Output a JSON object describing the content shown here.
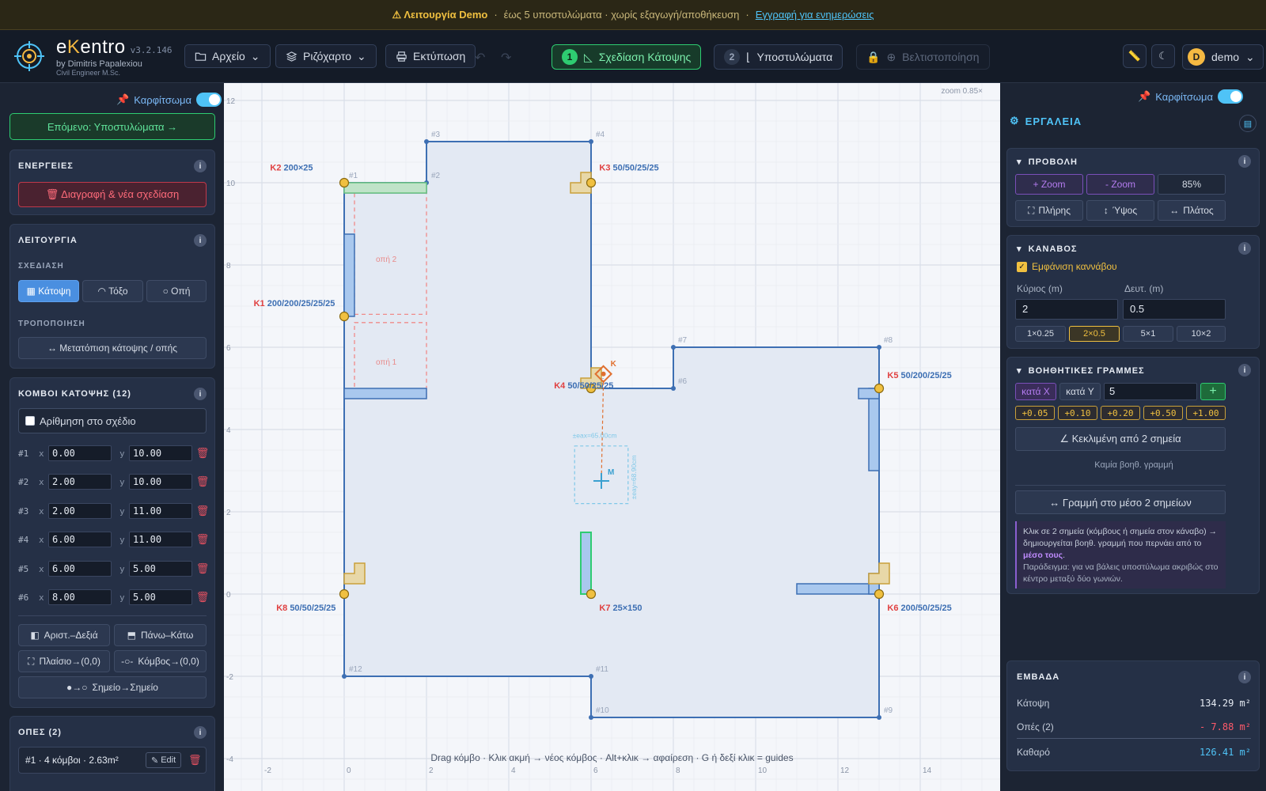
{
  "banner": {
    "warning": "⚠ Λειτουργία Demo",
    "sep1": "·",
    "limits": "έως 5 υποστυλώματα · χωρίς εξαγωγή/αποθήκευση",
    "sep2": "·",
    "link": "Εγγραφή για ενημερώσεις"
  },
  "header": {
    "brand_e": "e",
    "brand_k": "K",
    "brand_rest": "entro",
    "version": "v3.2.146",
    "by": "by Dimitris Papalexiou",
    "role": "Civil Engineer M.Sc.",
    "file_menu": "Αρχείο",
    "layers_menu": "Ριζόχαρτο",
    "print": "Εκτύπωση",
    "step1_num": "1",
    "step1_label": "Σχεδίαση Κάτοψης",
    "step2_num": "2",
    "step2_label": "Υποστυλώματα",
    "step3_label": "Βελτιστοποίηση",
    "user_initial": "D",
    "user_name": "demo"
  },
  "left": {
    "pin_label": "Καρφίτσωμα",
    "next_button": "Επόμενο: Υποστυλώματα →",
    "actions_title": "ΕΝΕΡΓΕΙΕΣ",
    "delete_button": "🗑 Διαγραφή & νέα σχεδίαση",
    "mode_title": "ΛΕΙΤΟΥΡΓΙΑ",
    "draw_sub": "ΣΧΕΔΙΑΣΗ",
    "mode_plan": "▦ Κάτοψη",
    "mode_arc": "◠ Τόξο",
    "mode_hole": "○ Οπή",
    "modify_sub": "ΤΡΟΠΟΠΟΙΗΣΗ",
    "move_button": "↔ Μετατόπιση κάτοψης / οπής",
    "nodes_title": "ΚΟΜΒΟΙ ΚΑΤΟΨΗΣ (12)",
    "numbering_label": "Αρίθμηση στο σχέδιο",
    "nodes": [
      {
        "id": "#1",
        "x": "0.00",
        "y": "10.00"
      },
      {
        "id": "#2",
        "x": "2.00",
        "y": "10.00"
      },
      {
        "id": "#3",
        "x": "2.00",
        "y": "11.00"
      },
      {
        "id": "#4",
        "x": "6.00",
        "y": "11.00"
      },
      {
        "id": "#5",
        "x": "6.00",
        "y": "5.00"
      },
      {
        "id": "#6",
        "x": "8.00",
        "y": "5.00"
      }
    ],
    "x_lbl": "x",
    "y_lbl": "y",
    "mirror_lr": "Αριστ.–Δεξιά",
    "mirror_ud": "Πάνω–Κάτω",
    "frame_origin": "Πλαίσιο→(0,0)",
    "node_origin": "Κόμβος→(0,0)",
    "point_point": "Σημείο→Σημείο",
    "holes_title": "ΟΠΕΣ (2)",
    "hole1": "#1 · 4 κόμβοι · 2.63m²",
    "edit": "Edit"
  },
  "canvas": {
    "zoom_label": "zoom 0.85×",
    "status": "Drag κόμβο · Κλικ ακμή → νέος κόμβος · Alt+κλικ → αφαίρεση · G ή δεξί κλικ = guides",
    "x_ticks": [
      "-2",
      "0",
      "2",
      "4",
      "6",
      "8",
      "10",
      "12",
      "14"
    ],
    "y_ticks": [
      "12",
      "10",
      "8",
      "6",
      "4",
      "2",
      "0",
      "-2",
      "-4"
    ],
    "node_labels": [
      "#1",
      "#2",
      "#3",
      "#4",
      "#5",
      "#6",
      "#7",
      "#8",
      "#9",
      "#10",
      "#11",
      "#12"
    ],
    "columns": [
      {
        "name": "K1",
        "dims": "200/200/25/25/25"
      },
      {
        "name": "K2",
        "dims": "200×25"
      },
      {
        "name": "K3",
        "dims": "50/50/25/25"
      },
      {
        "name": "K4",
        "dims": "50/50/25/25"
      },
      {
        "name": "K5",
        "dims": "50/200/25/25"
      },
      {
        "name": "K6",
        "dims": "200/50/25/25"
      },
      {
        "name": "K7",
        "dims": "25×150"
      },
      {
        "name": "K8",
        "dims": "50/50/25/25"
      }
    ],
    "hole1": "οπή 1",
    "hole2": "οπή 2",
    "k_marker": "K",
    "m_marker": "M",
    "ex_label": "±eax=65.00cm",
    "ey_label": "±eay=68.90cm"
  },
  "right": {
    "pin_label": "Καρφίτσωμα",
    "tools_title": "ΕΡΓΑΛΕΙΑ",
    "view_title": "ΠΡΟΒΟΛΗ",
    "zoom_in": "+ Zoom",
    "zoom_out": "- Zoom",
    "zoom_pct": "85%",
    "full": "Πλήρης",
    "height": "Ύψος",
    "width": "Πλάτος",
    "grid_title": "ΚΑΝΑΒΟΣ",
    "show_grid": "Εμφάνιση καννάβου",
    "main_label": "Κύριος (m)",
    "sec_label": "Δευτ. (m)",
    "main_val": "2",
    "sec_val": "0.5",
    "presets": [
      "1×0.25",
      "2×0.5",
      "5×1",
      "10×2"
    ],
    "guides_title": "ΒΟΗΘΗΤΙΚΕΣ ΓΡΑΜΜΕΣ",
    "by_x": "κατά X",
    "by_y": "κατά Y",
    "guide_val": "5",
    "add": "+",
    "offsets": [
      "+0.05",
      "+0.10",
      "+0.20",
      "+0.50",
      "+1.00"
    ],
    "slanted": "∠ Κεκλιμένη από 2 σημεία",
    "no_guides": "Καμία βοηθ. γραμμή",
    "mid_line": "↔ Γραμμή στο μέσο 2 σημείων",
    "help_1": "Κλικ σε 2 σημεία (κόμβους ή σημεία στον κάναβο) → δημιουργείται βοηθ. γραμμή που περνάει από το",
    "help_bold": "μέσο τους",
    "help_2": ".",
    "help_3": "Παράδειγμα: για να βάλεις υποστύλωμα ακριβώς στο κέντρο μεταξύ δύο γωνιών.",
    "areas_title": "ΕΜΒΑΔΑ",
    "plan_label": "Κάτοψη",
    "plan_val": "134.29 m²",
    "holes_label": "Οπές (2)",
    "holes_val": "- 7.88 m²",
    "net_label": "Καθαρό",
    "net_val": "126.41 m²"
  },
  "colors": {
    "accent_green": "#2ecc71",
    "column_fill": "#a9c8ee",
    "outline_blue": "#3d6fb3",
    "node_yellow": "#f0c040",
    "label_red": "#e04040"
  }
}
